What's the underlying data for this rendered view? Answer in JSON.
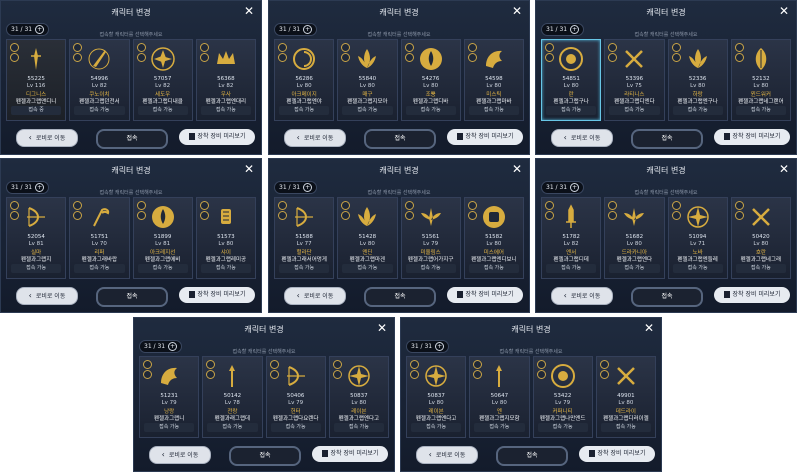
{
  "common": {
    "title": "캐릭터 변경",
    "count": "31 / 31",
    "hint": "접속할 캐릭터를 선택해주세요",
    "lobby_label": "로비로 이동",
    "connect_label": "접속",
    "preview_label": "장착 장비 미리보기",
    "status_available": "접속 가능"
  },
  "panels": [
    {
      "cards": [
        {
          "cp": "55225",
          "lv": "Lv 116",
          "cls": "디그니스",
          "name": "펜젤과그랩맨디니",
          "status": "접속 중",
          "emblem": "lance",
          "state": "dim"
        },
        {
          "cp": "54996",
          "lv": "Lv 82",
          "cls": "쿠노이치",
          "name": "펜젤과그랩던전서",
          "status": "접속 가능",
          "emblem": "knife",
          "state": ""
        },
        {
          "cp": "57057",
          "lv": "Lv 82",
          "cls": "세도우",
          "name": "펜젤과그랩디내클",
          "status": "접속 가능",
          "emblem": "flower",
          "state": ""
        },
        {
          "cp": "56368",
          "lv": "Lv 82",
          "cls": "우사",
          "name": "펜젤과그랩엔대리",
          "status": "접속 가능",
          "emblem": "crown",
          "state": ""
        }
      ]
    },
    {
      "cards": [
        {
          "cp": "56286",
          "lv": "Lv 80",
          "cls": "아크메이지",
          "name": "펜젤과그랩엔야",
          "status": "접속 가능",
          "emblem": "swirl",
          "state": ""
        },
        {
          "cp": "55840",
          "lv": "Lv 80",
          "cls": "매구",
          "name": "펜젤과그랩지모아",
          "status": "접속 가능",
          "emblem": "lotus",
          "state": ""
        },
        {
          "cp": "54276",
          "lv": "Lv 80",
          "cls": "조뿡",
          "name": "펜젤과그랩디바",
          "status": "접속 가능",
          "emblem": "lotus2",
          "state": ""
        },
        {
          "cp": "54598",
          "lv": "Lv 80",
          "cls": "미스틱",
          "name": "펜젤과그랩마바",
          "status": "접속 가능",
          "emblem": "dragon",
          "state": ""
        }
      ]
    },
    {
      "cards": [
        {
          "cp": "54851",
          "lv": "Lv 80",
          "cls": "란",
          "name": "펜젤과그랩구나",
          "status": "접속 가능",
          "emblem": "circle",
          "state": "sel"
        },
        {
          "cp": "53396",
          "lv": "Lv 75",
          "cls": "라티니스",
          "name": "펜젤과그랩디엔다",
          "status": "접속 가능",
          "emblem": "cross",
          "state": ""
        },
        {
          "cp": "52336",
          "lv": "Lv 80",
          "cls": "하랑",
          "name": "펜젤과그랩엔구나",
          "status": "접속 가능",
          "emblem": "lotus",
          "state": ""
        },
        {
          "cp": "52132",
          "lv": "Lv 80",
          "cls": "윈드워커",
          "name": "펜젤과그랩네그랜어",
          "status": "접속 가능",
          "emblem": "leaf",
          "state": ""
        }
      ]
    },
    {
      "cards": [
        {
          "cp": "52054",
          "lv": "Lv 81",
          "cls": "실마",
          "name": "펜젤과그랩지",
          "status": "접속 가능",
          "emblem": "bow",
          "state": ""
        },
        {
          "cp": "51751",
          "lv": "Lv 70",
          "cls": "리퍼",
          "name": "펜젤과그래바랍",
          "status": "접속 가능",
          "emblem": "scythe",
          "state": ""
        },
        {
          "cp": "51899",
          "lv": "Lv 81",
          "cls": "아크레지선",
          "name": "펜젤과그랩에비",
          "status": "접속 가능",
          "emblem": "lotus2",
          "state": ""
        },
        {
          "cp": "51573",
          "lv": "Lv 80",
          "cls": "샤이",
          "name": "펜젤과그랩레미공",
          "status": "접속 가능",
          "emblem": "lamp",
          "state": ""
        }
      ]
    },
    {
      "cards": [
        {
          "cp": "51588",
          "lv": "Lv 77",
          "cls": "헐라단",
          "name": "펜젤과그래서어멍게",
          "status": "접속 가능",
          "emblem": "bow",
          "state": ""
        },
        {
          "cp": "51428",
          "lv": "Lv 80",
          "cls": "엔딘",
          "name": "펜젤과그랩마겐",
          "status": "접속 가능",
          "emblem": "lotus",
          "state": ""
        },
        {
          "cp": "51561",
          "lv": "Lv 79",
          "cls": "미올림스",
          "name": "펜젤과그랩어가지구",
          "status": "접속 가능",
          "emblem": "wing",
          "state": ""
        },
        {
          "cp": "51582",
          "lv": "Lv 80",
          "cls": "미스에어",
          "name": "펜젤과그랩엔디보니",
          "status": "접속 가능",
          "emblem": "fist",
          "state": ""
        }
      ]
    },
    {
      "cards": [
        {
          "cp": "51782",
          "lv": "Lv 82",
          "cls": "엔서",
          "name": "펜젤과그랩디데",
          "status": "접속 가능",
          "emblem": "sword",
          "state": ""
        },
        {
          "cp": "51682",
          "lv": "Lv 80",
          "cls": "드라카니아",
          "name": "펜젤과그랩엔다",
          "status": "접속 가능",
          "emblem": "wing",
          "state": ""
        },
        {
          "cp": "51094",
          "lv": "Lv 71",
          "cls": "노바",
          "name": "펜젤과그랩엔들레",
          "status": "접속 가능",
          "emblem": "star",
          "state": ""
        },
        {
          "cp": "50420",
          "lv": "Lv 80",
          "cls": "호란",
          "name": "펜젤과그랩네그래",
          "status": "접속 가능",
          "emblem": "cross",
          "state": ""
        }
      ]
    },
    {
      "cards": [
        {
          "cp": "51231",
          "lv": "Lv 79",
          "cls": "낭랑",
          "name": "펜젤과그랩니",
          "status": "접속 가능",
          "emblem": "dragon",
          "state": ""
        },
        {
          "cp": "50142",
          "lv": "Lv 78",
          "cls": "전랑",
          "name": "펜젤과래그랩데",
          "status": "접속 가능",
          "emblem": "spear",
          "state": ""
        },
        {
          "cp": "50406",
          "lv": "Lv 79",
          "cls": "헌터",
          "name": "펜젤과그랩다요렌다",
          "status": "접속 가능",
          "emblem": "bow",
          "state": ""
        },
        {
          "cp": "50837",
          "lv": "Lv 80",
          "cls": "레이븐",
          "name": "펜젤과그랩엔다고",
          "status": "접속 가능",
          "emblem": "star",
          "state": ""
        }
      ]
    },
    {
      "cards": [
        {
          "cp": "50837",
          "lv": "Lv 80",
          "cls": "레이븐",
          "name": "펜젤과그랩엔다고",
          "status": "접속 가능",
          "emblem": "star",
          "state": ""
        },
        {
          "cp": "50647",
          "lv": "Lv 80",
          "cls": "엔",
          "name": "펜젤과그랩지모함",
          "status": "접속 가능",
          "emblem": "spear",
          "state": ""
        },
        {
          "cp": "53422",
          "lv": "Lv 79",
          "cls": "커퍼니티",
          "name": "펜젤과그랩나만엔드",
          "status": "접속 가능",
          "emblem": "circle",
          "state": ""
        },
        {
          "cp": "49901",
          "lv": "Lv 80",
          "cls": "데드라이",
          "name": "펜젤과그랩디러이젤",
          "status": "접속 가능",
          "emblem": "cross",
          "state": ""
        }
      ]
    }
  ]
}
